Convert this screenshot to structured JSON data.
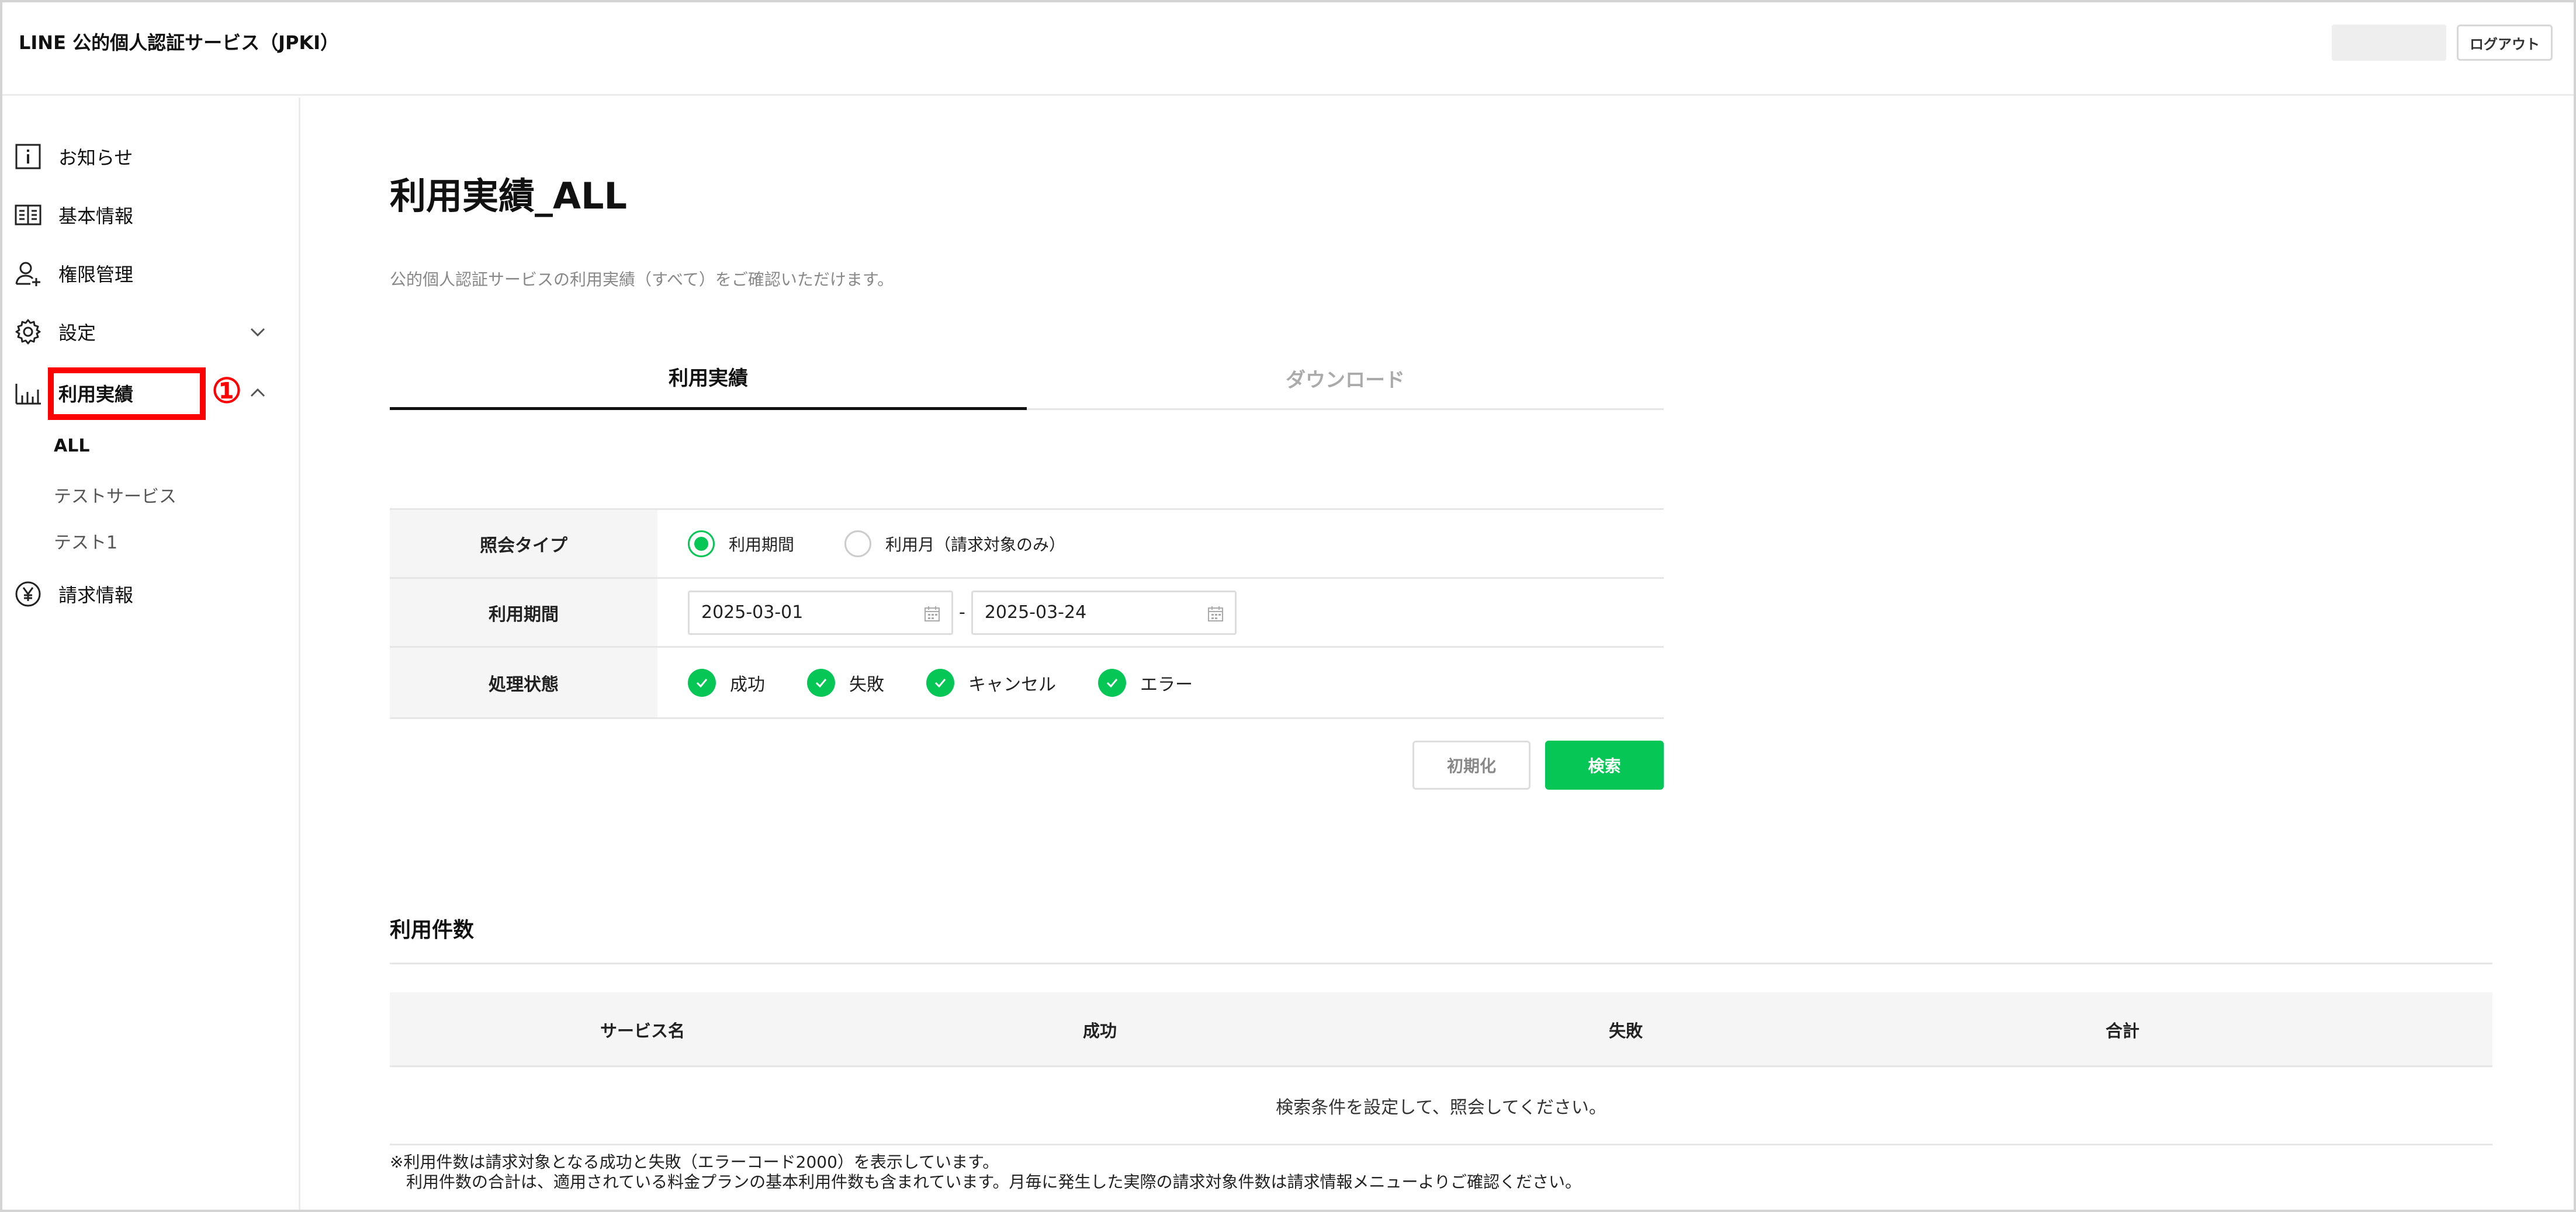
{
  "header": {
    "app_title": "LINE 公的個人認証サービス（JPKI）",
    "logout_label": "ログアウト"
  },
  "sidebar": {
    "items": [
      {
        "label": "お知らせ",
        "icon": "info-icon"
      },
      {
        "label": "基本情報",
        "icon": "book-icon"
      },
      {
        "label": "権限管理",
        "icon": "user-add-icon"
      },
      {
        "label": "設定",
        "icon": "gear-icon"
      },
      {
        "label": "利用実績",
        "icon": "bar-chart-icon"
      },
      {
        "label": "請求情報",
        "icon": "yen-icon"
      }
    ],
    "sub_items": [
      "ALL",
      "テストサービス",
      "テスト1"
    ],
    "callout": "①"
  },
  "main": {
    "title": "利用実績_ALL",
    "description": "公的個人認証サービスの利用実績（すべて）をご確認いただけます。",
    "tabs": [
      "利用実績",
      "ダウンロード"
    ],
    "form": {
      "type_label": "照会タイプ",
      "type_options": [
        "利用期間",
        "利用月（請求対象のみ）"
      ],
      "period_label": "利用期間",
      "date_from": "2025-03-01",
      "date_to": "2025-03-24",
      "date_sep": "-",
      "status_label": "処理状態",
      "status_options": [
        "成功",
        "失敗",
        "キャンセル",
        "エラー"
      ]
    },
    "buttons": {
      "reset": "初期化",
      "search": "検索"
    },
    "usage": {
      "title": "利用件数",
      "columns": [
        "サービス名",
        "成功",
        "失敗",
        "合計"
      ],
      "empty_message": "検索条件を設定して、照会してください。",
      "note1": "※利用件数は請求対象となる成功と失敗（エラーコード2000）を表示しています。",
      "note2": "利用件数の合計は、適用されている料金プランの基本利用件数も含まれています。月毎に発生した実際の請求対象件数は請求情報メニューよりご確認ください。"
    }
  },
  "colors": {
    "accent": "#06c755",
    "highlight": "#ff0000"
  }
}
